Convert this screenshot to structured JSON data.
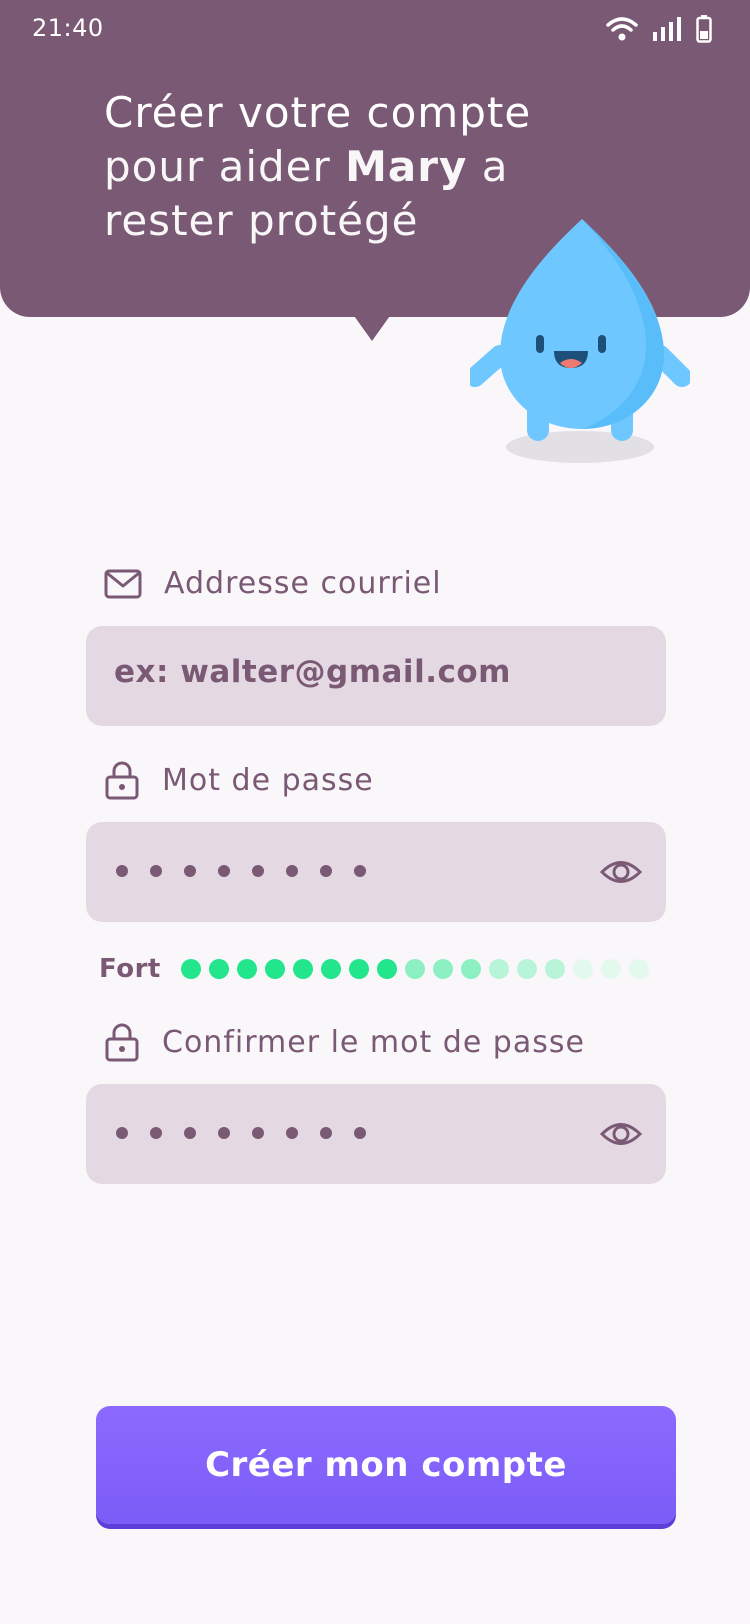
{
  "status_bar": {
    "time": "21:40"
  },
  "header": {
    "line1": "Créer votre compte",
    "line2_prefix": "pour aider ",
    "line2_name": "Mary",
    "line2_suffix": " a",
    "line3": "rester protégé"
  },
  "form": {
    "email": {
      "label": "Addresse courriel",
      "placeholder": "ex: walter@gmail.com"
    },
    "password": {
      "label": "Mot de passe",
      "masked_length": 8
    },
    "strength": {
      "label": "Fort",
      "level_filled": 8,
      "total": 17
    },
    "confirm": {
      "label": "Confirmer le mot de passe",
      "masked_length": 8
    }
  },
  "submit_label": "Créer mon compte",
  "colors": {
    "header": "#7A5974",
    "input_bg": "#E4D9E2",
    "accent": "#7B5CF6",
    "strength_strong": "#22E58C"
  }
}
